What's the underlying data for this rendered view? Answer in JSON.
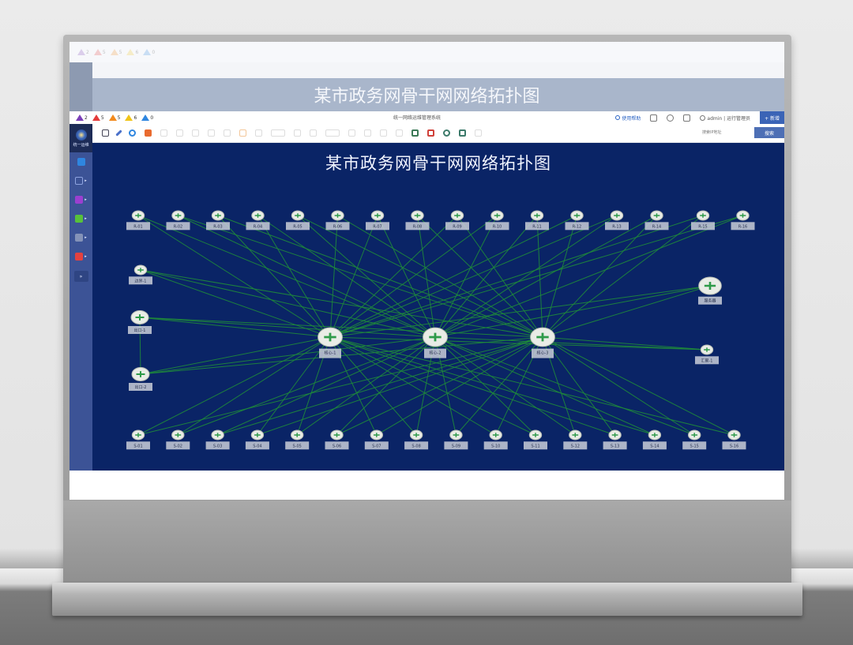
{
  "app": {
    "title": "统一网络运维管理系统",
    "page_title": "某市政务网骨干网网络拓扑图"
  },
  "alerts": [
    {
      "count": "2",
      "color": "#7b3fb8",
      "name": "critical"
    },
    {
      "count": "5",
      "color": "#e43b3b",
      "name": "major"
    },
    {
      "count": "5",
      "color": "#f28a1e",
      "name": "minor"
    },
    {
      "count": "6",
      "color": "#f0c419",
      "name": "warning"
    },
    {
      "count": "0",
      "color": "#2f86e0",
      "name": "info"
    }
  ],
  "topbar": {
    "help": "使用帮助",
    "user": "admin | 运行管理员",
    "action": "+ 新增"
  },
  "sidebar": {
    "logo_text": "统一运维",
    "items": [
      {
        "icon": "dashboard-icon",
        "color": "#2f86e0"
      },
      {
        "icon": "topology-icon",
        "color": "#3c5396"
      },
      {
        "icon": "monitor-icon",
        "color": "#9b3fd0"
      },
      {
        "icon": "grid-icon",
        "color": "#57c13b"
      },
      {
        "icon": "report-icon",
        "color": "#8492b8"
      },
      {
        "icon": "alarm-icon",
        "color": "#e4413f"
      }
    ],
    "collapse": "»"
  },
  "toolbar": {
    "search_placeholder": "搜索IP地址",
    "search_button": "搜索"
  },
  "topology": {
    "top_row": [
      "R-01",
      "R-02",
      "R-03",
      "R-04",
      "R-05",
      "R-06",
      "R-07",
      "R-08",
      "R-09",
      "R-10",
      "R-11",
      "R-12",
      "R-13",
      "R-14",
      "R-15",
      "R-16"
    ],
    "bottom_row": [
      "S-01",
      "S-02",
      "S-03",
      "S-04",
      "S-05",
      "S-06",
      "S-07",
      "S-08",
      "S-09",
      "S-10",
      "S-11",
      "S-12",
      "S-13",
      "S-14",
      "S-15",
      "S-16"
    ],
    "core": [
      "核心-1",
      "核心-2",
      "核心-3"
    ],
    "left": [
      "边界-1",
      "出口-1",
      "出口-2"
    ],
    "right": [
      "服务器",
      "汇聚-1"
    ]
  }
}
